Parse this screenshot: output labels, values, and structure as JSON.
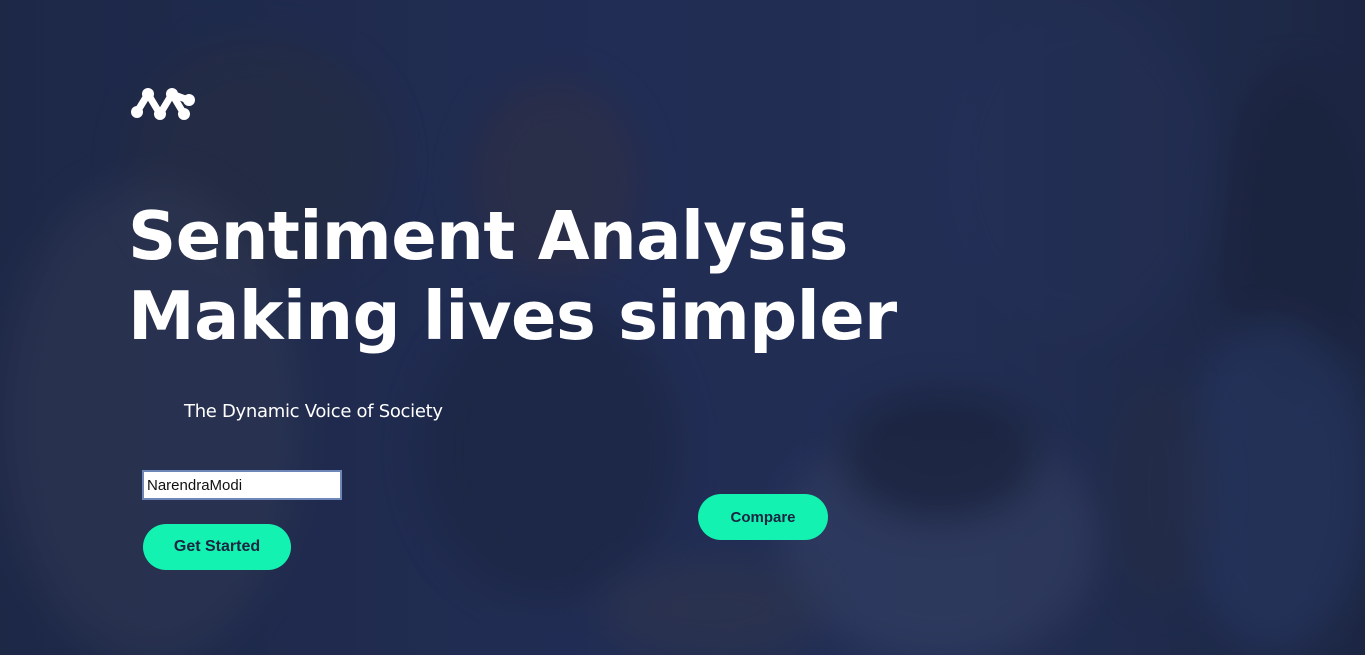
{
  "hero": {
    "logo_icon": "network-nodes-icon",
    "title_line1": "Sentiment Analysis",
    "title_line2": "Making lives simpler",
    "tagline": "The Dynamic Voice of Society"
  },
  "form": {
    "search_value": "NarendraModi",
    "get_started_label": "Get Started",
    "compare_label": "Compare"
  },
  "colors": {
    "accent": "#13f2b0",
    "background": "#1f2a48",
    "text": "#ffffff"
  }
}
